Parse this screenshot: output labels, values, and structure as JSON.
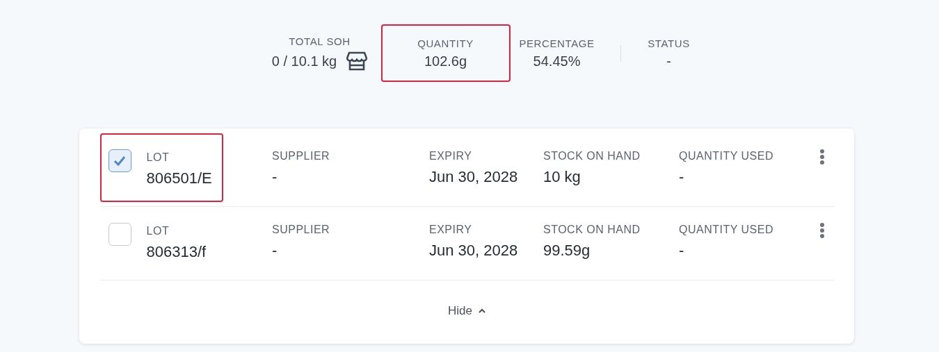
{
  "summary": [
    {
      "label": "TOTAL SOH",
      "value": "0 / 10.1 kg",
      "highlighted": false,
      "kind": "store"
    },
    {
      "label": "QUANTITY",
      "value": "102.6g",
      "highlighted": true,
      "kind": "plain"
    },
    {
      "label": "PERCENTAGE",
      "value": "54.45%",
      "highlighted": false,
      "kind": "plain"
    },
    {
      "label": "STATUS",
      "value": "-",
      "highlighted": false,
      "kind": "divided"
    }
  ],
  "lots": [
    {
      "checked": true,
      "highlighted": true,
      "lot_label": "LOT",
      "lot": "806501/E",
      "supplier_label": "SUPPLIER",
      "supplier": "-",
      "expiry_label": "EXPIRY",
      "expiry": "Jun 30, 2028",
      "soh_label": "STOCK ON HAND",
      "soh": "10 kg",
      "used_label": "QUANTITY USED",
      "used": "-"
    },
    {
      "checked": false,
      "highlighted": false,
      "lot_label": "LOT",
      "lot": "806313/f",
      "supplier_label": "SUPPLIER",
      "supplier": "-",
      "expiry_label": "EXPIRY",
      "expiry": "Jun 30, 2028",
      "soh_label": "STOCK ON HAND",
      "soh": "99.59g",
      "used_label": "QUANTITY USED",
      "used": "-"
    }
  ],
  "toggle": {
    "label": "Hide",
    "expanded": true
  }
}
